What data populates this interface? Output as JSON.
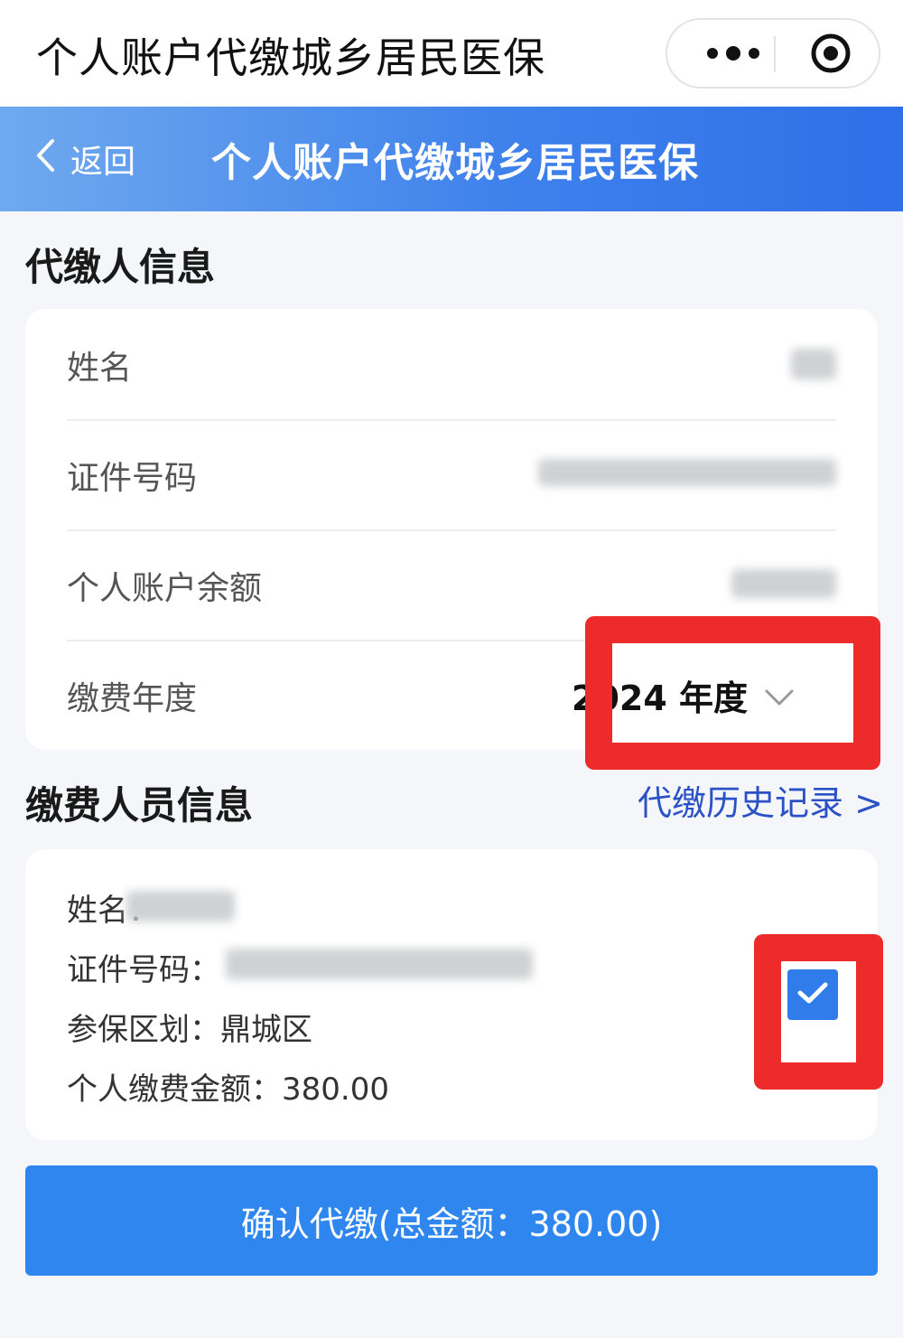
{
  "titlebar": {
    "title": "个人账户代缴城乡居民医保",
    "more_icon": "more-dots-icon",
    "close_icon": "target-circle-icon"
  },
  "header": {
    "back_label": "返回",
    "title": "个人账户代缴城乡居民医保"
  },
  "payer_section": {
    "title": "代缴人信息",
    "rows": [
      {
        "label": "姓名",
        "value": ""
      },
      {
        "label": "证件号码",
        "value": ""
      },
      {
        "label": "个人账户余额",
        "value": ""
      },
      {
        "label": "缴费年度",
        "value": "2024 年度"
      }
    ]
  },
  "insured_section": {
    "title": "缴费人员信息",
    "history_link": "代缴历史记录 >",
    "person": {
      "name_label": "姓名：",
      "id_label": "证件号码：",
      "region_label": "参保区划：",
      "region_value": "鼎城区",
      "amount_label": "个人缴费金额：",
      "amount_value": "380.00",
      "checked": true
    }
  },
  "confirm_button": {
    "label": "确认代缴(总金额：380.00)"
  },
  "colors": {
    "primary": "#2f86ef",
    "highlight": "#ee2b2b",
    "link": "#2a52c6"
  }
}
